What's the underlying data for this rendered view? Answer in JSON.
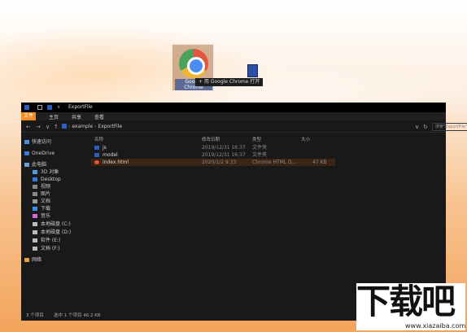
{
  "drag": {
    "icon_label": "Google Chrome",
    "tooltip": "+ 用 Google Chrome 打开"
  },
  "explorer": {
    "title": "ExportFile",
    "ribbon_tabs": [
      "文件",
      "主页",
      "共享",
      "查看"
    ],
    "breadcrumb": [
      "example",
      "ExportFile"
    ],
    "search_placeholder": "搜索\"ExportFile\"",
    "nav": [
      {
        "label": "快速访问",
        "icon": "star-icon",
        "color": "#4a90e2"
      },
      {
        "label": "OneDrive",
        "icon": "cloud-icon",
        "color": "#3a7bd5"
      },
      {
        "label": "此电脑",
        "icon": "computer-icon",
        "color": "#6aa0d8"
      },
      {
        "label": "3D 对象",
        "icon": "cube-icon",
        "color": "#4aa0e0"
      },
      {
        "label": "Desktop",
        "icon": "desktop-icon",
        "color": "#3a7bd5"
      },
      {
        "label": "视频",
        "icon": "video-icon",
        "color": "#888888"
      },
      {
        "label": "图片",
        "icon": "picture-icon",
        "color": "#888888"
      },
      {
        "label": "文档",
        "icon": "document-icon",
        "color": "#999999"
      },
      {
        "label": "下载",
        "icon": "download-icon",
        "color": "#3a8fe0"
      },
      {
        "label": "音乐",
        "icon": "music-icon",
        "color": "#d86ad8"
      },
      {
        "label": "本地磁盘 (C:)",
        "icon": "drive-icon",
        "color": "#bbbbbb"
      },
      {
        "label": "本地磁盘 (D:)",
        "icon": "drive-icon",
        "color": "#bbbbbb"
      },
      {
        "label": "软件 (E:)",
        "icon": "drive-icon",
        "color": "#bbbbbb"
      },
      {
        "label": "文档 (F:)",
        "icon": "drive-icon",
        "color": "#bbbbbb"
      },
      {
        "label": "网络",
        "icon": "network-icon",
        "color": "#e8a040"
      }
    ],
    "columns": [
      "名称",
      "修改日期",
      "类型",
      "大小"
    ],
    "files": [
      {
        "name": "js",
        "date": "2019/12/31 16:37",
        "type": "文件夹",
        "size": "",
        "icon": "folder-icon",
        "color": "#2d5fb8"
      },
      {
        "name": "model",
        "date": "2019/12/31 16:37",
        "type": "文件夹",
        "size": "",
        "icon": "folder-icon",
        "color": "#2d5fb8"
      },
      {
        "name": "index.html",
        "date": "2020/1/2 9:33",
        "type": "Chrome HTML D...",
        "size": "47 KB",
        "icon": "chrome-icon",
        "color": "#e2553f"
      }
    ],
    "status": {
      "count": "3 个项目",
      "selected": "选中 1 个项目  46.2 KB"
    }
  },
  "watermark": {
    "logo": "下载吧",
    "url": "www.xiazaiba.com"
  }
}
